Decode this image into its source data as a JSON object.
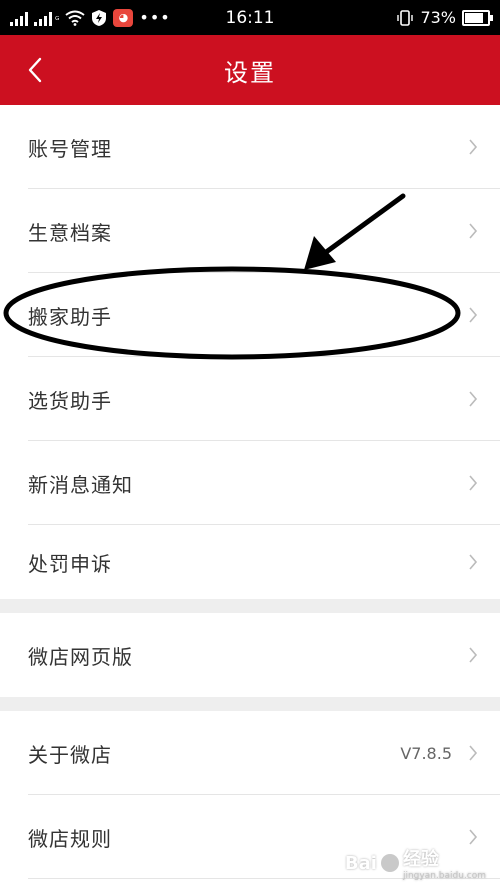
{
  "status_bar": {
    "network_label": "ᴳ",
    "time": "16:11",
    "battery_level": "73%",
    "battery_fraction": 0.73,
    "icons": [
      "signal-icon",
      "signal-icon",
      "wifi-icon",
      "shield-icon",
      "app-notification-icon",
      "more-dots-icon",
      "phone-vibrate-icon",
      "battery-icon"
    ]
  },
  "nav": {
    "title": "设置",
    "back_icon": "chevron-left-icon"
  },
  "colors": {
    "brand_red": "#cc1020",
    "divider": "#e5e5e5",
    "section_gap": "#eeeeee"
  },
  "settings_items": [
    {
      "label": "账号管理"
    },
    {
      "label": "生意档案"
    },
    {
      "label": "搬家助手"
    },
    {
      "label": "选货助手"
    },
    {
      "label": "新消息通知"
    },
    {
      "label": "处罚申诉"
    },
    {
      "label": "微店网页版"
    },
    {
      "label": "关于微店",
      "value": "V7.8.5"
    },
    {
      "label": "微店规则"
    }
  ],
  "watermark": {
    "text": "Bai",
    "text2": "经验",
    "subtext": "jingyan.baidu.com"
  }
}
